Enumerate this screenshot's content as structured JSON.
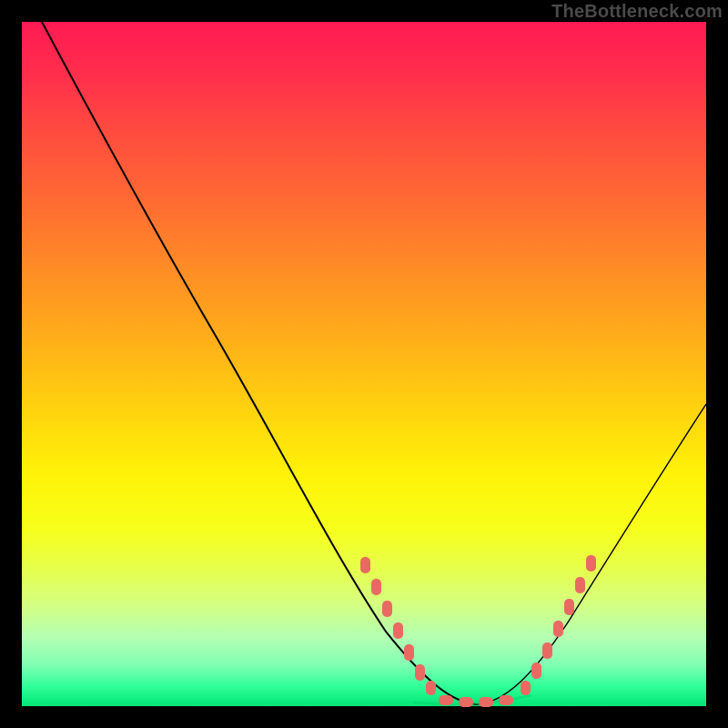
{
  "watermark": "TheBottleneck.com",
  "chart_data": {
    "type": "line",
    "title": "",
    "xlabel": "",
    "ylabel": "",
    "xlim": [
      0,
      100
    ],
    "ylim": [
      0,
      100
    ],
    "series": [
      {
        "name": "bottleneck-v-curve",
        "x": [
          5,
          12,
          20,
          28,
          36,
          44,
          50,
          54,
          58,
          62,
          66,
          70,
          74,
          78,
          84,
          90,
          100
        ],
        "y": [
          100,
          88,
          76,
          63,
          50,
          36,
          23,
          14,
          6,
          1,
          0,
          0,
          3,
          10,
          24,
          38,
          60
        ]
      }
    ],
    "highlight_dots": {
      "name": "near-optimal-samples",
      "x": [
        51,
        53,
        55,
        57,
        60,
        63,
        66,
        69,
        72,
        74,
        76,
        78,
        80,
        82
      ],
      "y": [
        21,
        17,
        13,
        9,
        4,
        1,
        0,
        0,
        1,
        4,
        8,
        12,
        17,
        22
      ]
    }
  }
}
